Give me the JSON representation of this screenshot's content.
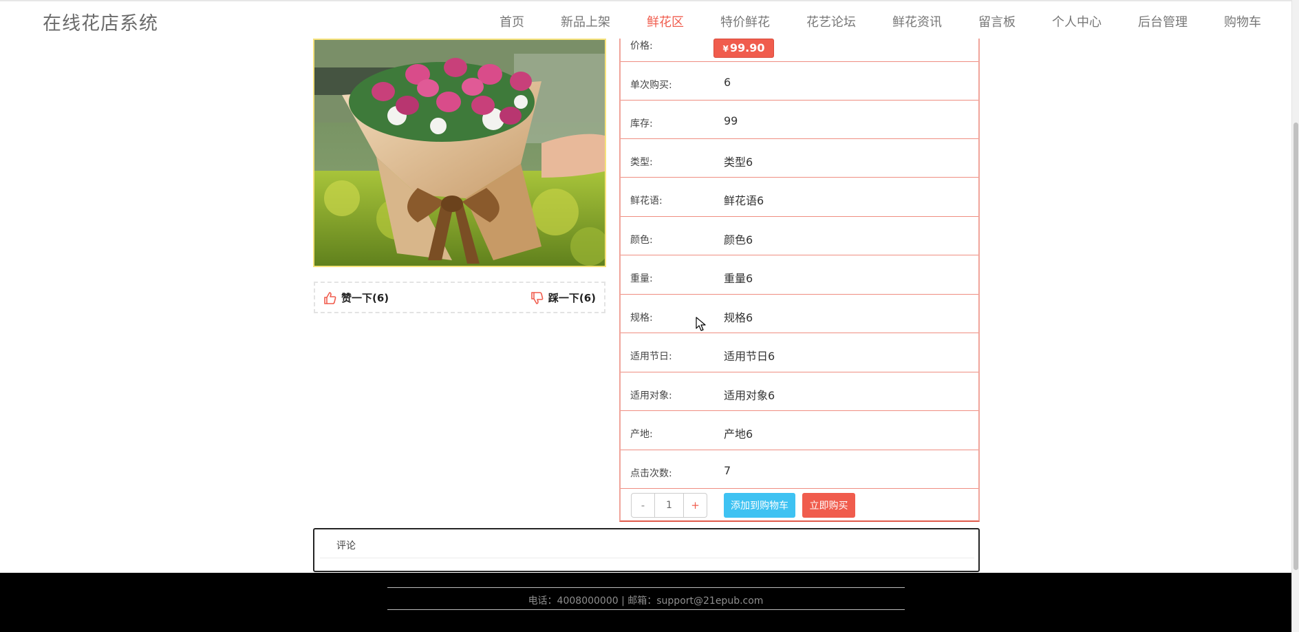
{
  "header": {
    "brand": "在线花店系统",
    "nav": [
      "首页",
      "新品上架",
      "鲜花区",
      "特价鲜花",
      "花艺论坛",
      "鲜花资讯",
      "留言板",
      "个人中心",
      "后台管理",
      "购物车"
    ],
    "active_nav": "鲜花区"
  },
  "product": {
    "image_icon": "flower-bouquet-image",
    "vote": {
      "up_label": "赞一下(6)",
      "down_label": "踩一下(6)",
      "up_icon": "thumbs-up-icon",
      "down_icon": "thumbs-down-icon"
    },
    "price": {
      "label": "价格:",
      "currency": "¥",
      "value": "99.90"
    },
    "rows": [
      {
        "label": "单次购买:",
        "value": "6"
      },
      {
        "label": "库存:",
        "value": "99"
      },
      {
        "label": "类型:",
        "value": "类型6"
      },
      {
        "label": "鲜花语:",
        "value": "鲜花语6"
      },
      {
        "label": "颜色:",
        "value": "颜色6"
      },
      {
        "label": "重量:",
        "value": "重量6"
      },
      {
        "label": "规格:",
        "value": "规格6"
      },
      {
        "label": "适用节日:",
        "value": "适用节日6"
      },
      {
        "label": "适用对象:",
        "value": "适用对象6"
      },
      {
        "label": "产地:",
        "value": "产地6"
      },
      {
        "label": "点击次数:",
        "value": "7"
      }
    ],
    "quantity": {
      "minus": "-",
      "value": "1",
      "plus": "+"
    },
    "buttons": {
      "add_to_cart": "添加到购物车",
      "buy_now": "立即购买"
    }
  },
  "comments": {
    "title": "评论"
  },
  "footer": {
    "text": "电话：4008000000 | 邮箱：support@21epub.com"
  },
  "colors": {
    "accent": "#f05c4d",
    "cart_button": "#3ec2f2",
    "footer_bg": "#000000",
    "row_border": "#ef8d80"
  }
}
